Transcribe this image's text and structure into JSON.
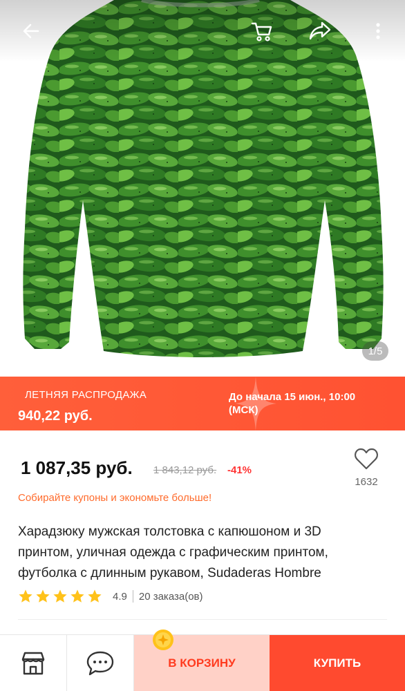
{
  "gallery": {
    "counter": "1/5"
  },
  "sale_banner": {
    "title": "ЛЕТНЯЯ РАСПРОДАЖА",
    "price": "940,22 руб.",
    "start_time": "До начала 15 июн., 10:00 (МСК)"
  },
  "pricing": {
    "current_price": "1 087,35 руб.",
    "original_price": "1 843,12 руб.",
    "discount": "-41%",
    "coupon_text": "Собирайте купоны и экономьте больше!"
  },
  "favorites": {
    "count": "1632"
  },
  "product": {
    "title": "Харадзюку мужская толстовка с капюшоном и 3D принтом, уличная одежда с графическим принтом, футболка с длинным рукавом, Sudaderas Hombre",
    "rating": "4.9",
    "orders": "20 заказа(ов)",
    "stars": 5
  },
  "actions": {
    "add_to_cart": "В КОРЗИНУ",
    "buy": "КУПИТЬ"
  },
  "icons": {
    "back": "arrow-left-icon",
    "cart": "cart-icon",
    "share": "share-icon",
    "more": "more-vertical-icon",
    "heart": "heart-icon",
    "star": "star-icon",
    "store": "store-icon",
    "chat": "chat-icon",
    "coin": "coin-icon"
  },
  "colors": {
    "accent": "#ff4a2f",
    "banner": "#ff5a36",
    "cart_button_bg": "#ffd1c7",
    "star": "#ffc21a",
    "coupon_text": "#ff6b2c"
  }
}
